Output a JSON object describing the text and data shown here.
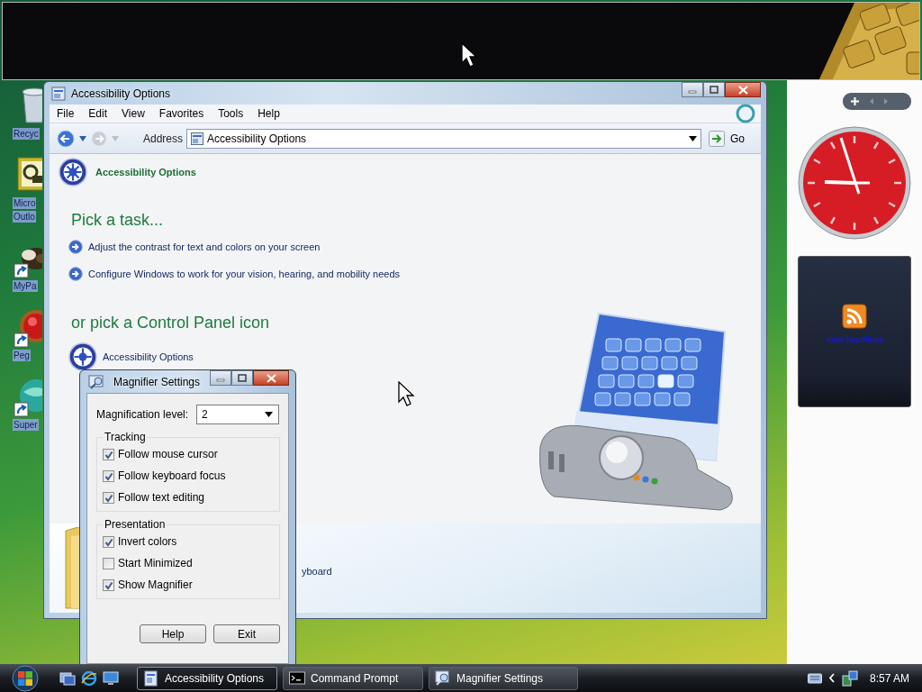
{
  "desktop_icons": [
    {
      "lines": [
        "Recyc"
      ],
      "kind": "bin",
      "shortcut": false
    },
    {
      "lines": [
        "Micro",
        "Outlo"
      ],
      "kind": "mail",
      "shortcut": false
    },
    {
      "lines": [
        "MyPa"
      ],
      "kind": "pet",
      "shortcut": true
    },
    {
      "lines": [
        "Peg"
      ],
      "kind": "ball",
      "shortcut": true
    },
    {
      "lines": [
        "Super"
      ],
      "kind": "globe",
      "shortcut": true
    }
  ],
  "explorer": {
    "title": "Accessibility Options",
    "menu": [
      "File",
      "Edit",
      "View",
      "Favorites",
      "Tools",
      "Help"
    ],
    "address_label": "Address",
    "address": "Accessibility Options",
    "go": "Go",
    "breadcrumb": "Accessibility Options",
    "task_heading": "Pick a task...",
    "tasks": [
      "Adjust the contrast for text and colors on your screen",
      "Configure Windows to work for your vision, hearing, and mobility needs"
    ],
    "icon_heading": "or pick a Control Panel icon",
    "icons": [
      "Accessibility Options"
    ],
    "partial_item": "yboard"
  },
  "magnifier_settings": {
    "title": "Magnifier Settings",
    "level_label": "Magnification level:",
    "level_value": "2",
    "groups": [
      {
        "title": "Tracking",
        "options": [
          {
            "label": "Follow mouse cursor",
            "checked": true
          },
          {
            "label": "Follow keyboard focus",
            "checked": true
          },
          {
            "label": "Follow text editing",
            "checked": true
          }
        ]
      },
      {
        "title": "Presentation",
        "options": [
          {
            "label": "Invert colors",
            "checked": true
          },
          {
            "label": "Start Minimized",
            "checked": false
          },
          {
            "label": "Show Magnifier",
            "checked": true
          }
        ]
      }
    ],
    "buttons": [
      "Help",
      "Exit"
    ]
  },
  "sidebar": {
    "feed_text": "View headlines"
  },
  "taskbar": {
    "tasks": [
      {
        "label": "Accessibility Options",
        "selected": true,
        "kind": "explorer"
      },
      {
        "label": "Command Prompt",
        "selected": false,
        "kind": "console"
      },
      {
        "label": "Magnifier Settings",
        "selected": false,
        "kind": "magnifier"
      }
    ],
    "clock": "8:57 AM"
  }
}
